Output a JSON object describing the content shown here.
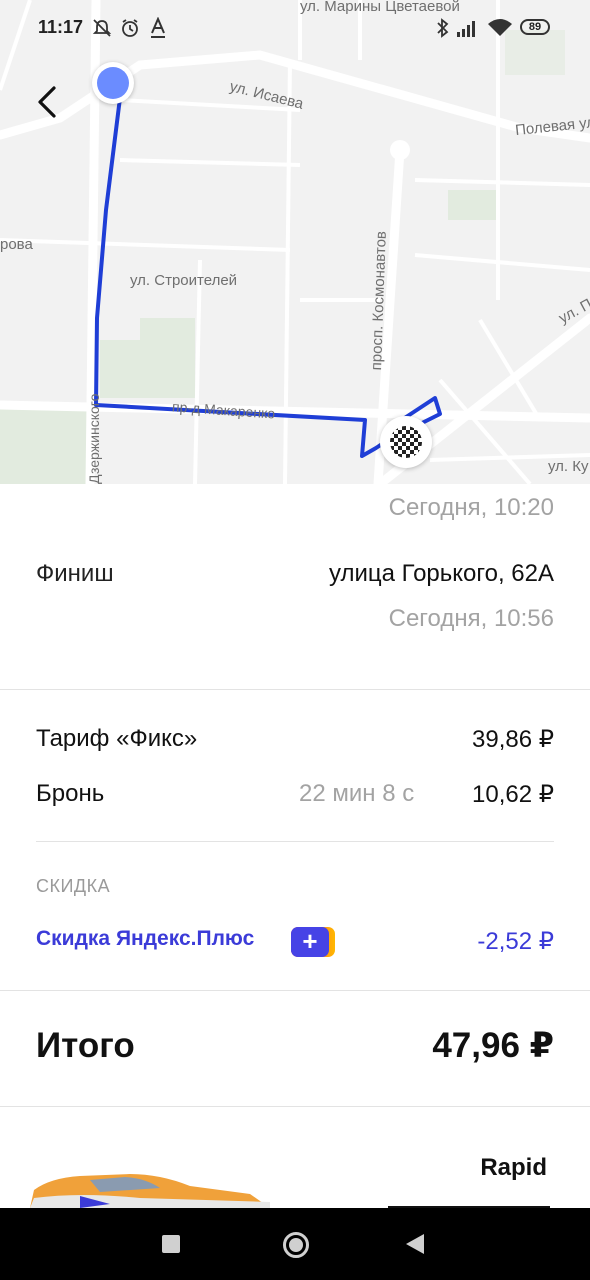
{
  "status_bar": {
    "time": "11:17",
    "battery": "89"
  },
  "map": {
    "streets": [
      "ул. Марины Цветаевой",
      "ул. Исаева",
      "Полевая ул",
      "рова",
      "ул. Строителей",
      "просп. Космонавтов",
      "ул. П",
      "Дзержинского",
      "пр-д Макаренко",
      "ул. Ку"
    ],
    "route_color": "#1f3ed6",
    "start_marker_color": "#6b8cff"
  },
  "trip": {
    "start_time": "Сегодня, 10:20",
    "finish_label": "Финиш",
    "finish_address": "улица Горького, 62А",
    "finish_time": "Сегодня, 10:56"
  },
  "cost": {
    "tariff_label": "Тариф «Фикс»",
    "tariff_value": "39,86 ₽",
    "booking_label": "Бронь",
    "booking_duration": "22 мин 8 с",
    "booking_value": "10,62 ₽",
    "discount_header": "СКИДКА",
    "discount_label": "Скидка Яндекс.Плюс",
    "discount_value": "-2,52 ₽",
    "discount_color": "#3b3bd8",
    "total_label": "Итого",
    "total_value": "47,96 ₽"
  },
  "car": {
    "model": "Rapid"
  }
}
